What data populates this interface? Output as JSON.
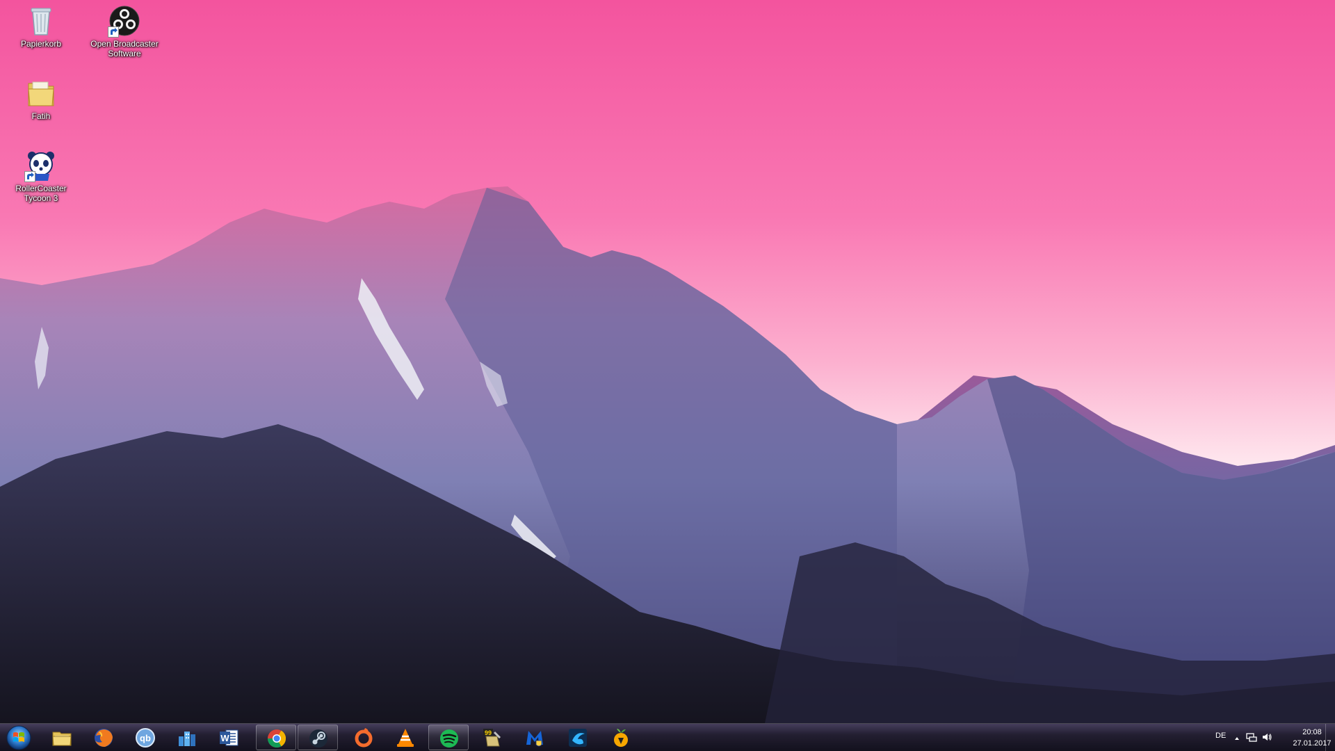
{
  "desktop": {
    "icons": [
      {
        "label": "Papierkorb",
        "icon": "recycle-bin-icon"
      },
      {
        "label": "Open Broadcaster Software",
        "icon": "obs-icon"
      },
      {
        "label": "Fatih",
        "icon": "folder-icon"
      },
      {
        "label": "RollerCoaster Tycoon 3",
        "icon": "panda-icon"
      }
    ]
  },
  "taskbar": {
    "start_icon": "windows-logo-icon",
    "pinned": [
      {
        "app": "explorer",
        "icon": "folder-icon",
        "running": false
      },
      {
        "app": "firefox",
        "icon": "firefox-icon",
        "running": false
      },
      {
        "app": "qbittorrent",
        "icon": "qbittorrent-icon",
        "running": false
      },
      {
        "app": "city",
        "icon": "city-icon",
        "running": false
      },
      {
        "app": "word",
        "icon": "word-icon",
        "running": false
      },
      {
        "app": "chrome",
        "icon": "chrome-icon",
        "running": true
      },
      {
        "app": "steam",
        "icon": "steam-icon",
        "running": true
      },
      {
        "app": "origin",
        "icon": "origin-icon",
        "running": false
      },
      {
        "app": "vlc",
        "icon": "vlc-icon",
        "running": false
      },
      {
        "app": "spotify",
        "icon": "spotify-icon",
        "running": true
      },
      {
        "app": "99",
        "icon": "badge-99-icon",
        "running": false
      },
      {
        "app": "malwarebytes",
        "icon": "malwarebytes-icon",
        "running": false
      },
      {
        "app": "origin-dark",
        "icon": "blue-swirl-icon",
        "running": false
      },
      {
        "app": "fl-studio",
        "icon": "fruit-icon",
        "running": false
      }
    ],
    "tray": {
      "language": "DE",
      "time": "20:08",
      "date": "27.01.2017",
      "icons": [
        "chevron-up-icon",
        "network-icon",
        "volume-icon"
      ]
    }
  },
  "colors": {
    "sky_top": "#f3559f",
    "sky_mid": "#fb8fbe",
    "horizon": "#fde6ee",
    "mountain_light": "#b79ac6",
    "mountain_dark": "#2c2a48"
  }
}
